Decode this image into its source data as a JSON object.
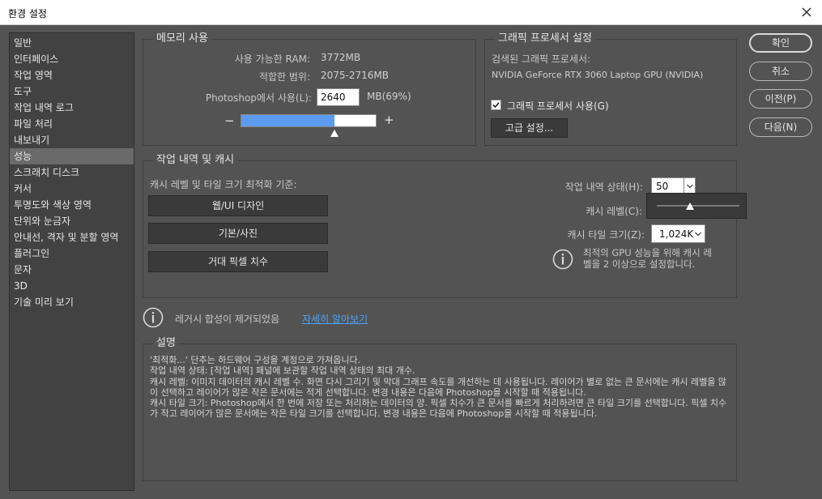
{
  "window": {
    "title": "환경 설정"
  },
  "sidebar": {
    "items": [
      {
        "label": "일반"
      },
      {
        "label": "인터페이스"
      },
      {
        "label": "작업 영역"
      },
      {
        "label": "도구"
      },
      {
        "label": "작업 내역 로그"
      },
      {
        "label": "파일 처리"
      },
      {
        "label": "내보내기"
      },
      {
        "label": "성능"
      },
      {
        "label": "스크래치 디스크"
      },
      {
        "label": "커서"
      },
      {
        "label": "투명도와 색상 영역"
      },
      {
        "label": "단위와 눈금자"
      },
      {
        "label": "안내선, 격자 및 분할 영역"
      },
      {
        "label": "플러그인"
      },
      {
        "label": "문자"
      },
      {
        "label": "3D"
      },
      {
        "label": "기술 미리 보기"
      }
    ],
    "selected": "성능"
  },
  "memory": {
    "title": "메모리 사용",
    "available_label": "사용 가능한 RAM:",
    "available_value": "3772MB",
    "ideal_label": "적합한 범위:",
    "ideal_value": "2075-2716MB",
    "use_label": "Photoshop에서 사용(L):",
    "use_value": "2640",
    "use_unit": "MB(69%)",
    "minus": "−",
    "plus": "+",
    "slider_fraction": 0.69
  },
  "gpu": {
    "title": "그래픽 프로세서 설정",
    "detected_label": "검색된 그래픽 프로세서:",
    "detected_value": "NVIDIA GeForce RTX 3060 Laptop GPU (NVIDIA)",
    "use_checkbox_label": "그래픽 프로세서 사용(G)",
    "use_checked": true,
    "advanced_button": "고급 설정..."
  },
  "history": {
    "title": "작업 내역 및 캐시",
    "optimize_label": "캐시 레벨 및 타일 크기 최적화 기준:",
    "btn_web": "웹/UI 디자인",
    "btn_default": "기본/사진",
    "btn_huge": "거대 픽셀 치수",
    "states_label": "작업 내역 상태(H):",
    "states_value": "50",
    "cache_levels_label": "캐시 레벨(C):",
    "tile_size_label": "캐시 타일 크기(Z):",
    "tile_size_value": "1,024K",
    "gpu_note": "최적의 GPU 성능을 위해 캐시 레벨을 2 이상으로 설정합니다.",
    "gpu_note_line1": "최적의 GPU 성능을 위해 캐시 레",
    "gpu_note_line2": "벨을 2 이상으로 설정합니다."
  },
  "legacy": {
    "text": "레거시 합성이 제거되었음",
    "link": "자세히 알아보기"
  },
  "description": {
    "title": "설명",
    "lines": [
      "'최적화...' 단추는 하드웨어 구성을 계정으로 가져옵니다.",
      "작업 내역 상태: [작업 내역] 패널에 보관할 작업 내역 상태의 최대 개수.",
      "캐시 레벨: 이미지 데이터의 캐시 레벨 수. 화면 다시 그리기 및 막대 그래프 속도를 개선하는 데 사용됩니다. 레이어가 별로 없는 큰 문서에는 캐시 레벨을 많이 선택하고 레이어가 많은 작은 문서에는 적게 선택합니다. 변경 내용은 다음에 Photoshop을 시작할 때 적용됩니다.",
      "캐시 타일 크기: Photoshop에서 한 번에 저장 또는 처리하는 데이터의 양. 픽셀 치수가 큰 문서를 빠르게 처리하려면 큰 타일 크기를 선택합니다. 픽셀 치수가 작고 레이어가 많은 문서에는 작은 타일 크기를 선택합니다. 변경 내용은 다음에 Photoshop을 시작할 때 적용됩니다."
    ]
  },
  "buttons": {
    "ok": "확인",
    "cancel": "취소",
    "prev": "이전(P)",
    "next": "다음(N)"
  },
  "colors": {
    "slider_fill": "#5b9bf0",
    "link": "#4aa3ff"
  }
}
